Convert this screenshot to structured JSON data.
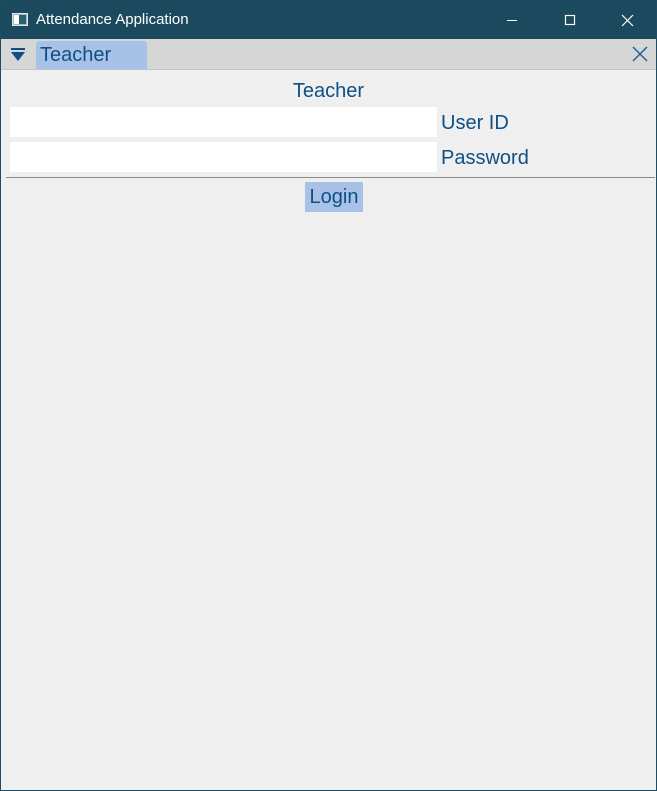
{
  "window": {
    "title": "Attendance Application",
    "icon": "app-window-icon",
    "controls": [
      "minimize-icon",
      "maximize-icon",
      "close-icon"
    ]
  },
  "tabbar": {
    "menu_icon": "dropdown-triangle-icon",
    "tabs": [
      {
        "label": "Teacher",
        "active": true
      }
    ],
    "close_icon": "close-icon"
  },
  "main": {
    "title": "Teacher",
    "fields": [
      {
        "label": "User ID",
        "value": "",
        "placeholder": ""
      },
      {
        "label": "Password",
        "value": "",
        "placeholder": ""
      }
    ],
    "login_label": "Login"
  },
  "colors": {
    "titlebar": "#1b4a5e",
    "tabbar": "#d6d6d6",
    "accent": "#a7c2e6",
    "text": "#0f4f86",
    "background": "#efefef"
  }
}
